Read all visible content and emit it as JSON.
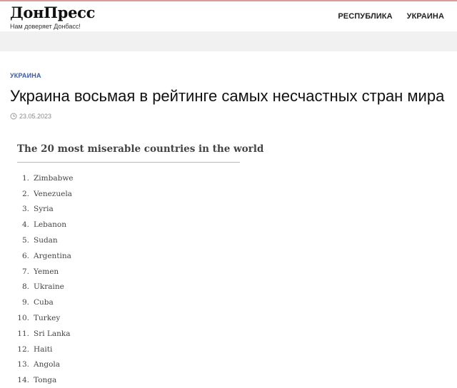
{
  "site": {
    "logo": "ДонПресс",
    "tagline": "Нам доверяет Донбасс!"
  },
  "nav": {
    "items": [
      {
        "label": "РЕСПУБЛИКА"
      },
      {
        "label": "УКРАИНА"
      }
    ]
  },
  "article": {
    "category": "УКРАИНА",
    "title": "Украина восьмая в рейтинге самых несчастных стран мира",
    "date": "23.05.2023"
  },
  "figure": {
    "title": "The 20 most miserable countries in the world",
    "items": [
      {
        "num": "1.",
        "name": "Zimbabwe"
      },
      {
        "num": "2.",
        "name": "Venezuela"
      },
      {
        "num": "3.",
        "name": "Syria"
      },
      {
        "num": "4.",
        "name": "Lebanon"
      },
      {
        "num": "5.",
        "name": "Sudan"
      },
      {
        "num": "6.",
        "name": "Argentina"
      },
      {
        "num": "7.",
        "name": "Yemen"
      },
      {
        "num": "8.",
        "name": "Ukraine"
      },
      {
        "num": "9.",
        "name": "Cuba"
      },
      {
        "num": "10.",
        "name": "Turkey"
      },
      {
        "num": "11.",
        "name": "Sri Lanka"
      },
      {
        "num": "12.",
        "name": "Haiti"
      },
      {
        "num": "13.",
        "name": "Angola"
      },
      {
        "num": "14.",
        "name": "Tonga"
      }
    ]
  },
  "colors": {
    "accent_category": "#3a5aa8",
    "top_line": "#d99a9a"
  },
  "icons": {
    "date": "clock-icon"
  }
}
